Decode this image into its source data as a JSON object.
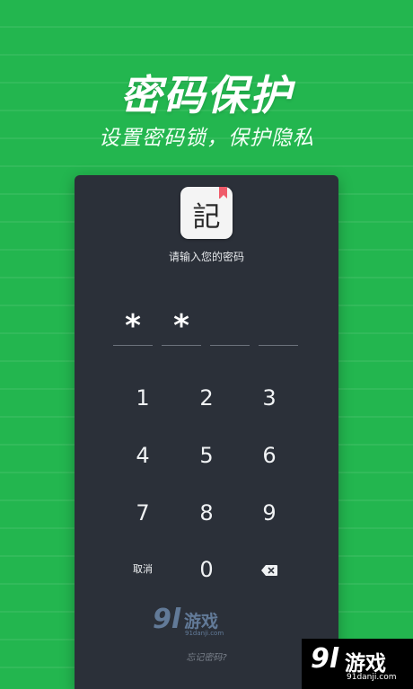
{
  "header": {
    "title": "密码保护",
    "subtitle": "设置密码锁，保护隐私"
  },
  "lock_screen": {
    "app_icon": {
      "glyph": "記",
      "icon": "notebook-app-icon",
      "bookmark_color": "#ef5b6a"
    },
    "prompt": "请输入您的密码",
    "pin": {
      "entered": [
        "*",
        "*",
        "",
        ""
      ],
      "length": 4
    },
    "keypad": {
      "keys": [
        "1",
        "2",
        "3",
        "4",
        "5",
        "6",
        "7",
        "8",
        "9"
      ],
      "cancel_label": "取消",
      "zero_label": "0",
      "delete_icon": "backspace-icon"
    },
    "forgot_label": "忘记密码?"
  },
  "watermark": {
    "number": "9l",
    "name": "游戏",
    "url": "91danji.com"
  },
  "colors": {
    "background": "#23b64f",
    "panel": "#2b3039",
    "text": "#f0f2f4",
    "muted": "#7c838d"
  }
}
